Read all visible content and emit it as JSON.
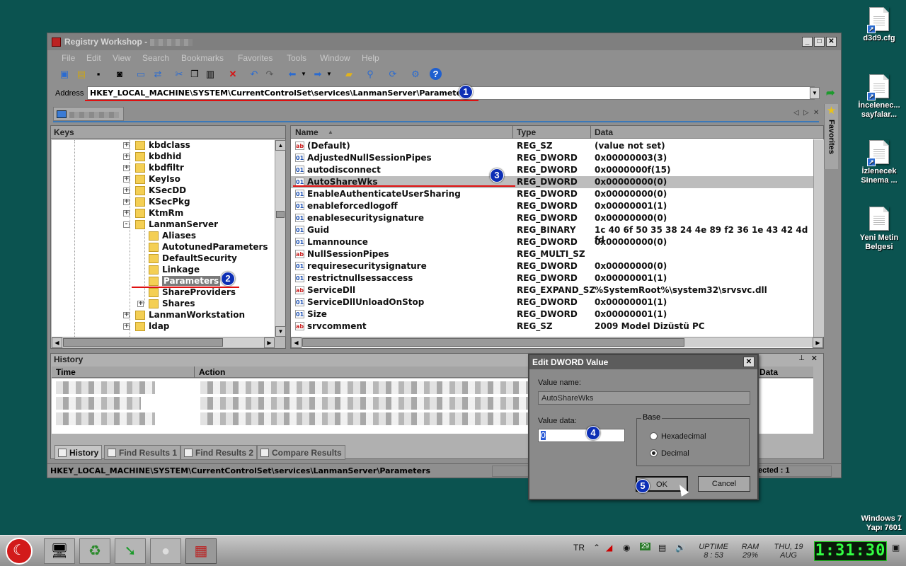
{
  "window": {
    "title": "Registry Workshop -"
  },
  "menu": [
    "File",
    "Edit",
    "View",
    "Search",
    "Bookmarks",
    "Favorites",
    "Tools",
    "Window",
    "Help"
  ],
  "address": {
    "label": "Address",
    "value": "HKEY_LOCAL_MACHINE\\SYSTEM\\CurrentControlSet\\services\\LanmanServer\\Parameters"
  },
  "favorites_label": "Favorites",
  "keys": {
    "header": "Keys",
    "items": [
      {
        "label": "kbdclass",
        "level": 0,
        "expander": "+"
      },
      {
        "label": "kbdhid",
        "level": 0,
        "expander": "+"
      },
      {
        "label": "kbdfiltr",
        "level": 0,
        "expander": "+"
      },
      {
        "label": "KeyIso",
        "level": 0,
        "expander": "+"
      },
      {
        "label": "KSecDD",
        "level": 0,
        "expander": "+"
      },
      {
        "label": "KSecPkg",
        "level": 0,
        "expander": "+"
      },
      {
        "label": "KtmRm",
        "level": 0,
        "expander": "+"
      },
      {
        "label": "LanmanServer",
        "level": 0,
        "expander": "-"
      },
      {
        "label": "Aliases",
        "level": 1,
        "expander": ""
      },
      {
        "label": "AutotunedParameters",
        "level": 1,
        "expander": ""
      },
      {
        "label": "DefaultSecurity",
        "level": 1,
        "expander": ""
      },
      {
        "label": "Linkage",
        "level": 1,
        "expander": ""
      },
      {
        "label": "Parameters",
        "level": 1,
        "expander": "",
        "selected": true
      },
      {
        "label": "ShareProviders",
        "level": 1,
        "expander": ""
      },
      {
        "label": "Shares",
        "level": 1,
        "expander": "+"
      },
      {
        "label": "LanmanWorkstation",
        "level": 0,
        "expander": "+"
      },
      {
        "label": "ldap",
        "level": 0,
        "expander": "+"
      }
    ]
  },
  "values": {
    "columns": {
      "name": "Name",
      "type": "Type",
      "data": "Data"
    },
    "rows": [
      {
        "name": "(Default)",
        "type": "REG_SZ",
        "data": "(value not set)",
        "icon": "ab"
      },
      {
        "name": "AdjustedNullSessionPipes",
        "type": "REG_DWORD",
        "data": "0x00000003(3)",
        "icon": "bin"
      },
      {
        "name": "autodisconnect",
        "type": "REG_DWORD",
        "data": "0x0000000f(15)",
        "icon": "bin"
      },
      {
        "name": "AutoShareWks",
        "type": "REG_DWORD",
        "data": "0x00000000(0)",
        "icon": "bin",
        "selected": true
      },
      {
        "name": "EnableAuthenticateUserSharing",
        "type": "REG_DWORD",
        "data": "0x00000000(0)",
        "icon": "bin"
      },
      {
        "name": "enableforcedlogoff",
        "type": "REG_DWORD",
        "data": "0x00000001(1)",
        "icon": "bin"
      },
      {
        "name": "enablesecuritysignature",
        "type": "REG_DWORD",
        "data": "0x00000000(0)",
        "icon": "bin"
      },
      {
        "name": "Guid",
        "type": "REG_BINARY",
        "data": "1c 40 6f 50 35 38 24 4e 89 f2 36 1e 43 42 4d fd",
        "icon": "bin"
      },
      {
        "name": "Lmannounce",
        "type": "REG_DWORD",
        "data": "0x00000000(0)",
        "icon": "bin"
      },
      {
        "name": "NullSessionPipes",
        "type": "REG_MULTI_SZ",
        "data": "",
        "icon": "ab"
      },
      {
        "name": "requiresecuritysignature",
        "type": "REG_DWORD",
        "data": "0x00000000(0)",
        "icon": "bin"
      },
      {
        "name": "restrictnullsessaccess",
        "type": "REG_DWORD",
        "data": "0x00000001(1)",
        "icon": "bin"
      },
      {
        "name": "ServiceDll",
        "type": "REG_EXPAND_SZ",
        "data": "%SystemRoot%\\system32\\srvsvc.dll",
        "icon": "ab"
      },
      {
        "name": "ServiceDllUnloadOnStop",
        "type": "REG_DWORD",
        "data": "0x00000001(1)",
        "icon": "bin"
      },
      {
        "name": "Size",
        "type": "REG_DWORD",
        "data": "0x00000001(1)",
        "icon": "bin"
      },
      {
        "name": "srvcomment",
        "type": "REG_SZ",
        "data": "2009 Model Dizüstü PC",
        "icon": "ab"
      }
    ]
  },
  "history": {
    "header": "History",
    "col_time": "Time",
    "col_action": "Action",
    "col_data": "Data",
    "tabs": [
      "History",
      "Find Results 1",
      "Find Results 2",
      "Compare Results"
    ]
  },
  "status": {
    "path": "HKEY_LOCAL_MACHINE\\SYSTEM\\CurrentControlSet\\services\\LanmanServer\\Parameters",
    "selected": "ected : 1"
  },
  "dialog": {
    "title": "Edit DWORD Value",
    "value_name_label": "Value name:",
    "value_name": "AutoShareWks",
    "value_data_label": "Value data:",
    "value_data": "0",
    "base_label": "Base",
    "hex_label": "Hexadecimal",
    "dec_label": "Decimal",
    "base_selected": "Decimal",
    "ok": "OK",
    "cancel": "Cancel"
  },
  "annotations": [
    "1",
    "2",
    "3",
    "4",
    "5"
  ],
  "desktop": {
    "icons": [
      "d3d9.cfg",
      "İncelenec... sayfalar...",
      "İzlenecek Sinema ...",
      "Yeni Metin Belgesi"
    ],
    "os_line1": "Windows 7",
    "os_line2": "Yapı 7601"
  },
  "taskbar": {
    "lang": "TR",
    "tray_badge": "29",
    "uptime_label": "UPTIME",
    "uptime_value": "8 : 53",
    "ram_label": "RAM",
    "ram_value": "29%",
    "date_line1": "THU, 19",
    "date_line2": "AUG",
    "clock": "1:31:30"
  },
  "colors": {
    "desktop": "#0b5350",
    "annotation_line": "#e01010",
    "annotation_badge": "#0d2fb5",
    "clock_text": "#33ff44"
  }
}
